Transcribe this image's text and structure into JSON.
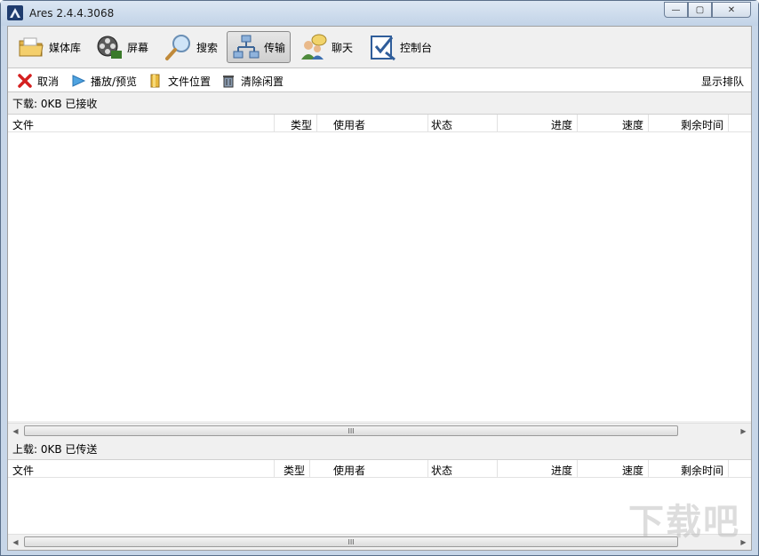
{
  "window": {
    "title": "Ares 2.4.4.3068"
  },
  "window_controls": {
    "minimize": "—",
    "maximize": "▢",
    "close": "✕"
  },
  "toolbar": {
    "items": [
      {
        "label": "媒体库",
        "icon": "folder-icon"
      },
      {
        "label": "屏幕",
        "icon": "film-reel-icon"
      },
      {
        "label": "搜索",
        "icon": "magnifier-icon"
      },
      {
        "label": "传输",
        "icon": "network-transfer-icon",
        "active": true
      },
      {
        "label": "聊天",
        "icon": "chat-users-icon"
      },
      {
        "label": "控制台",
        "icon": "checklist-icon"
      }
    ]
  },
  "actions": {
    "cancel": "取消",
    "play_preview": "播放/预览",
    "file_location": "文件位置",
    "clear_idle": "清除闲置",
    "show_queue": "显示排队"
  },
  "download": {
    "header": "下载: 0KB 已接收",
    "columns": [
      "文件",
      "类型",
      "使用者",
      "状态",
      "进度",
      "速度",
      "剩余时间"
    ]
  },
  "upload": {
    "header": "上载: 0KB 已传送",
    "columns": [
      "文件",
      "类型",
      "使用者",
      "状态",
      "进度",
      "速度",
      "剩余时间"
    ]
  },
  "scrollbar": {
    "grip": "III",
    "left_arrow": "◀",
    "right_arrow": "▶"
  },
  "watermark": "下载吧",
  "colors": {
    "accent": "#c7d6e8",
    "active_tab": "#d4d4d4"
  }
}
